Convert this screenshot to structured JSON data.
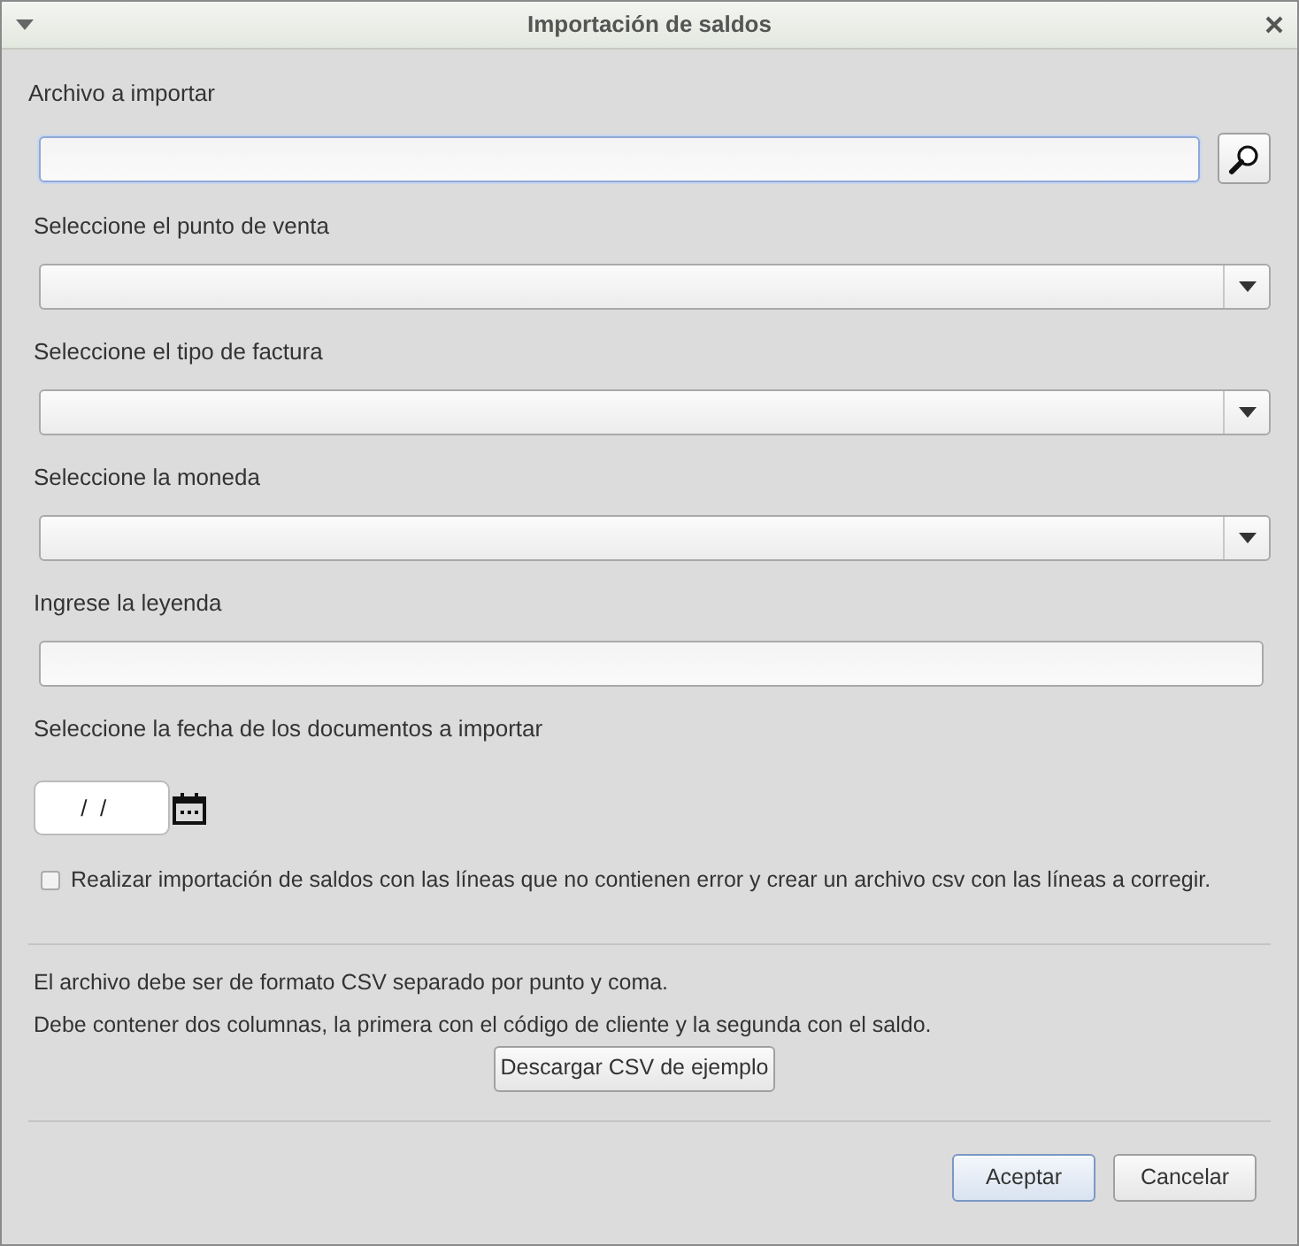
{
  "window": {
    "title": "Importación de saldos"
  },
  "fields": [
    {
      "kind": "file",
      "label": "Archivo a importar",
      "focused": true
    },
    {
      "kind": "select",
      "label": "Seleccione el punto de venta",
      "focused": false
    },
    {
      "kind": "select",
      "label": "Seleccione el tipo de factura",
      "focused": false
    },
    {
      "kind": "select",
      "label": "Seleccione la moneda",
      "focused": false
    },
    {
      "kind": "text",
      "label": "Ingrese la leyenda",
      "focused": false
    },
    {
      "kind": "date",
      "label": "Seleccione la fecha de los documentos a importar",
      "value": " /  /",
      "focused": false
    }
  ],
  "checkbox": {
    "label": "Realizar importación de saldos con las líneas que no contienen error y crear un archivo csv con las líneas a corregir.",
    "checked": false
  },
  "info": [
    "El archivo debe ser de formato CSV separado por punto y coma.",
    "Debe contener dos columnas, la primera con el código de cliente y la segunda con el saldo."
  ],
  "sample_button": "Descargar CSV de ejemplo",
  "buttons": [
    {
      "label": "Aceptar",
      "default": true
    },
    {
      "label": "Cancelar",
      "default": false
    }
  ]
}
